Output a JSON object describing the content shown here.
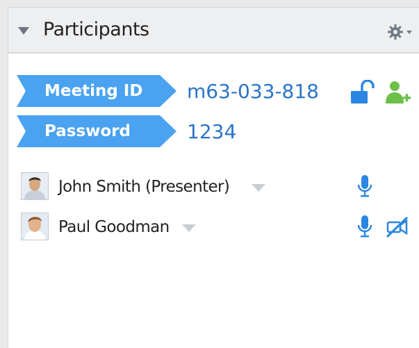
{
  "panel": {
    "title": "Participants"
  },
  "meeting": {
    "id_label": "Meeting ID",
    "id_value": "m63-033-818",
    "password_label": "Password",
    "password_value": "1234"
  },
  "participants": [
    {
      "name": "John Smith (Presenter)",
      "icons": [
        "microphone-icon"
      ]
    },
    {
      "name": "Paul Goodman",
      "icons": [
        "microphone-icon",
        "video-off-icon"
      ]
    }
  ],
  "icons": {
    "collapse": "collapse-triangle-icon",
    "settings": "gear-icon",
    "lock": "unlock-icon",
    "invite": "add-user-icon"
  },
  "colors": {
    "accent": "#4aa2f0",
    "value_text": "#2a74c9",
    "add_user_green": "#6cc04a",
    "header_bg": "#eeeff1"
  }
}
